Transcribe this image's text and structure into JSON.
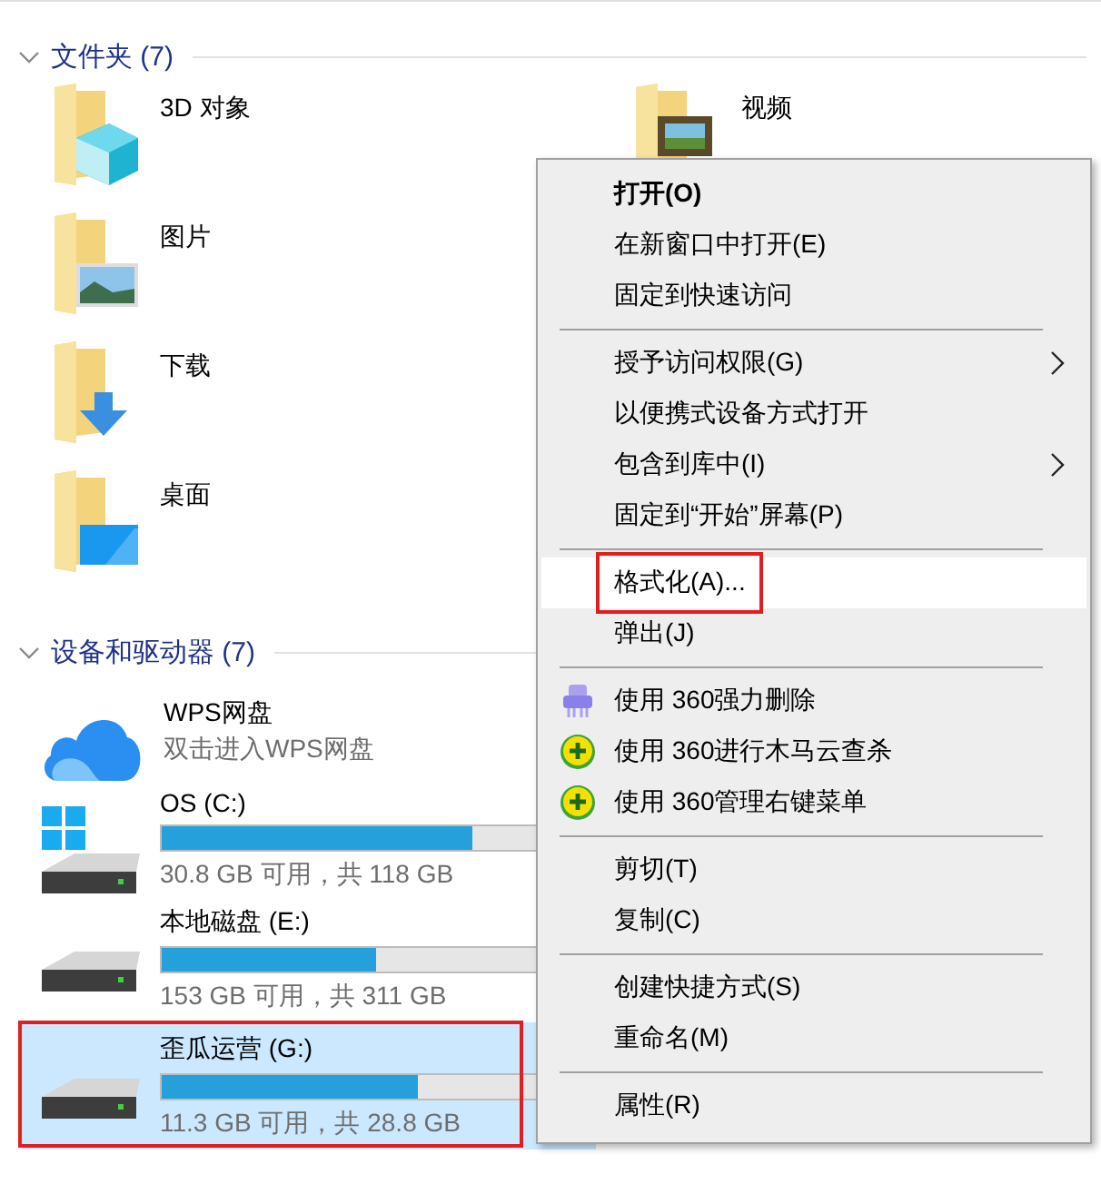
{
  "folders_section": {
    "title": "文件夹 (7)",
    "expanded": true,
    "folders": [
      {
        "kind": "objects3d",
        "name": "3D 对象"
      },
      {
        "kind": "pictures",
        "name": "图片"
      },
      {
        "kind": "downloads",
        "name": "下载"
      },
      {
        "kind": "desktop",
        "name": "桌面"
      },
      {
        "kind": "videos",
        "name": "视频"
      }
    ]
  },
  "drives_section": {
    "title": "设备和驱动器 (7)",
    "expanded": true,
    "drives": [
      {
        "kind": "cloud",
        "name": "WPS网盘",
        "caption": "双击进入WPS网盘",
        "selected": false,
        "annotated": false
      },
      {
        "kind": "system",
        "name": "OS (C:)",
        "level": 0.739,
        "caption": "30.8 GB 可用，共 118 GB",
        "selected": false,
        "annotated": false
      },
      {
        "kind": "disk",
        "name": "本地磁盘 (E:)",
        "level": 0.508,
        "caption": "153 GB 可用，共 311 GB",
        "selected": false,
        "annotated": false
      },
      {
        "kind": "disk",
        "name": "歪瓜运营 (G:)",
        "level": 0.608,
        "caption": "11.3 GB 可用，共 28.8 GB",
        "selected": true,
        "annotated": true
      }
    ]
  },
  "context_menu": {
    "items": [
      {
        "kind": "item",
        "label": "打开(O)",
        "default": true,
        "selected": false,
        "annotated": false
      },
      {
        "kind": "item",
        "label": "在新窗口中打开(E)",
        "default": false,
        "selected": false,
        "annotated": false
      },
      {
        "kind": "item",
        "label": "固定到快速访问",
        "default": false,
        "selected": false,
        "annotated": false
      },
      {
        "kind": "separator"
      },
      {
        "kind": "submenu",
        "label": "授予访问权限(G)",
        "default": false,
        "selected": false,
        "annotated": false
      },
      {
        "kind": "item",
        "label": "以便携式设备方式打开",
        "default": false,
        "selected": false,
        "annotated": false
      },
      {
        "kind": "submenu",
        "label": "包含到库中(I)",
        "default": false,
        "selected": false,
        "annotated": false
      },
      {
        "kind": "item",
        "label": "固定到“开始”屏幕(P)",
        "default": false,
        "selected": false,
        "annotated": false
      },
      {
        "kind": "separator"
      },
      {
        "kind": "item",
        "label": "格式化(A)...",
        "default": false,
        "selected": true,
        "annotated": true
      },
      {
        "kind": "item",
        "label": "弹出(J)",
        "default": false,
        "selected": false,
        "annotated": false
      },
      {
        "kind": "separator"
      },
      {
        "kind": "shredder",
        "label": "使用 360强力删除",
        "default": false,
        "selected": false,
        "annotated": false
      },
      {
        "kind": "guard",
        "label": "使用 360进行木马云查杀",
        "default": false,
        "selected": false,
        "annotated": false
      },
      {
        "kind": "guard",
        "label": "使用 360管理右键菜单",
        "default": false,
        "selected": false,
        "annotated": false
      },
      {
        "kind": "separator"
      },
      {
        "kind": "item",
        "label": "剪切(T)",
        "default": false,
        "selected": false,
        "annotated": false
      },
      {
        "kind": "item",
        "label": "复制(C)",
        "default": false,
        "selected": false,
        "annotated": false
      },
      {
        "kind": "separator"
      },
      {
        "kind": "item",
        "label": "创建快捷方式(S)",
        "default": false,
        "selected": false,
        "annotated": false
      },
      {
        "kind": "item",
        "label": "重命名(M)",
        "default": false,
        "selected": false,
        "annotated": false
      },
      {
        "kind": "separator"
      },
      {
        "kind": "item",
        "label": "属性(R)",
        "default": false,
        "selected": false,
        "annotated": false
      }
    ]
  }
}
